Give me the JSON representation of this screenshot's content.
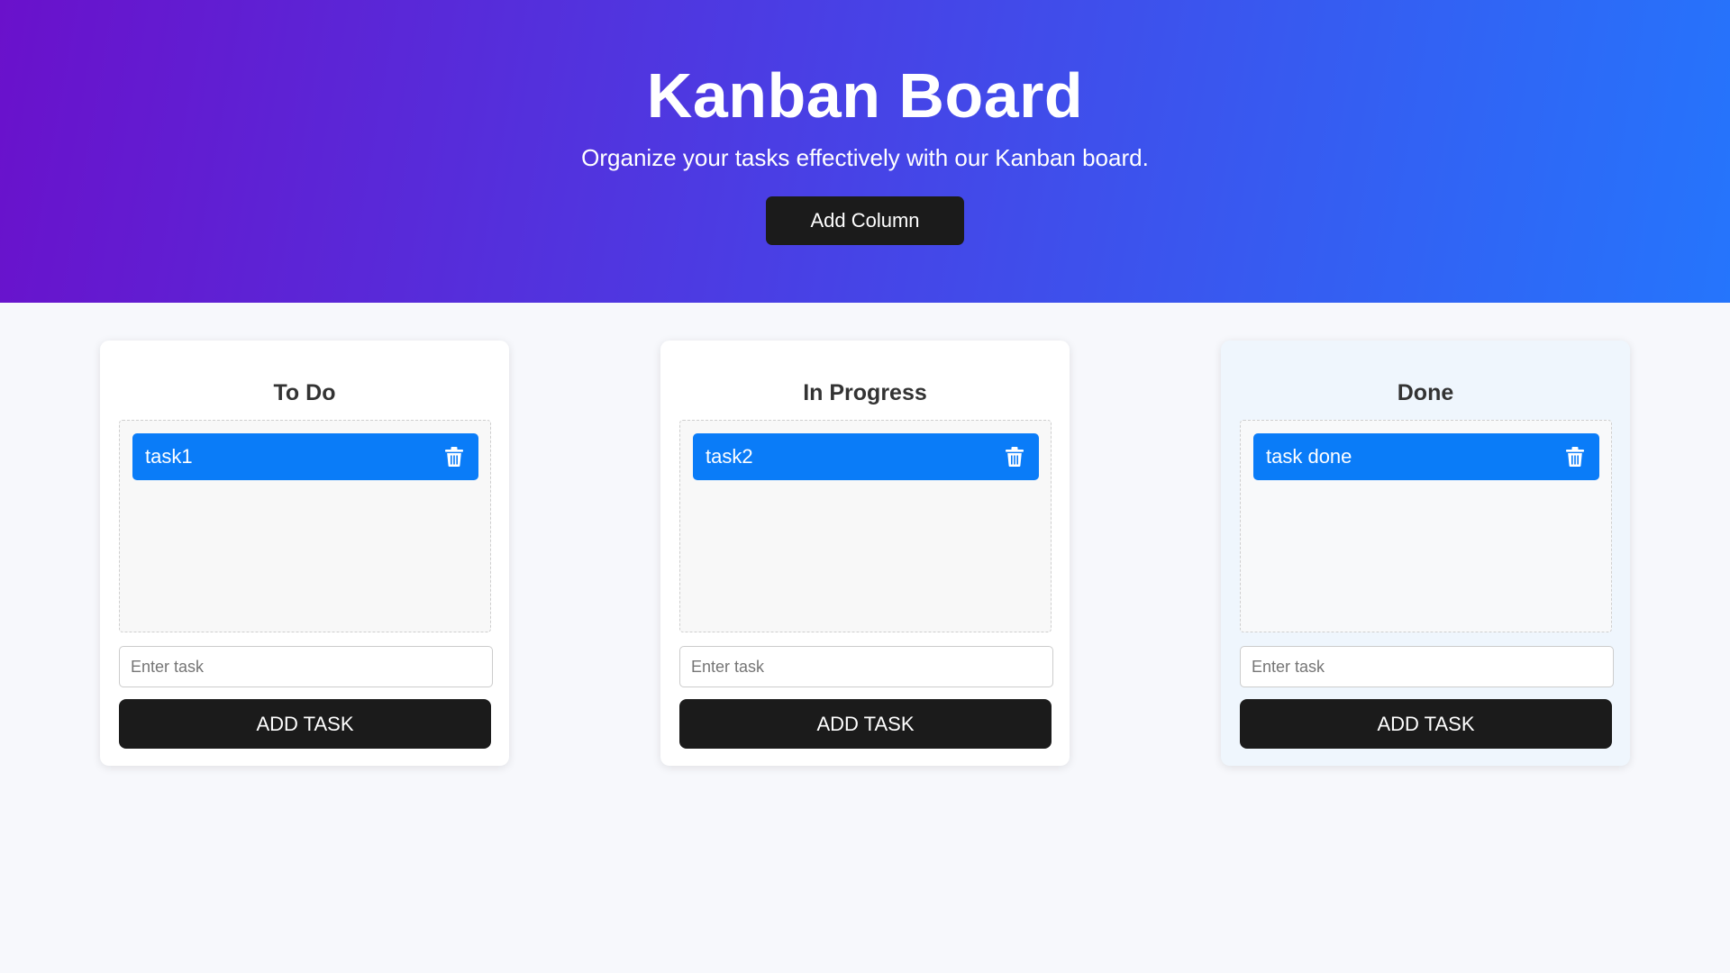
{
  "header": {
    "title": "Kanban Board",
    "subtitle": "Organize your tasks effectively with our Kanban board.",
    "add_column_label": "Add Column"
  },
  "columns": [
    {
      "title": "To Do",
      "tasks": [
        {
          "text": "task1",
          "icon": "trash-icon"
        }
      ],
      "input_placeholder": "Enter task",
      "input_value": "",
      "add_task_label": "ADD TASK"
    },
    {
      "title": "In Progress",
      "tasks": [
        {
          "text": "task2",
          "icon": "trash-icon"
        }
      ],
      "input_placeholder": "Enter task",
      "input_value": "",
      "add_task_label": "ADD TASK"
    },
    {
      "title": "Done",
      "tasks": [
        {
          "text": "task done",
          "icon": "trash-icon"
        }
      ],
      "input_placeholder": "Enter task",
      "input_value": "",
      "add_task_label": "ADD TASK"
    }
  ],
  "colors": {
    "header_gradient_start": "#6a11cb",
    "header_gradient_end": "#2575fc",
    "task_card": "#0a7cf8",
    "button_dark": "#1b1b1b",
    "done_column_bg": "#eff6fd"
  }
}
